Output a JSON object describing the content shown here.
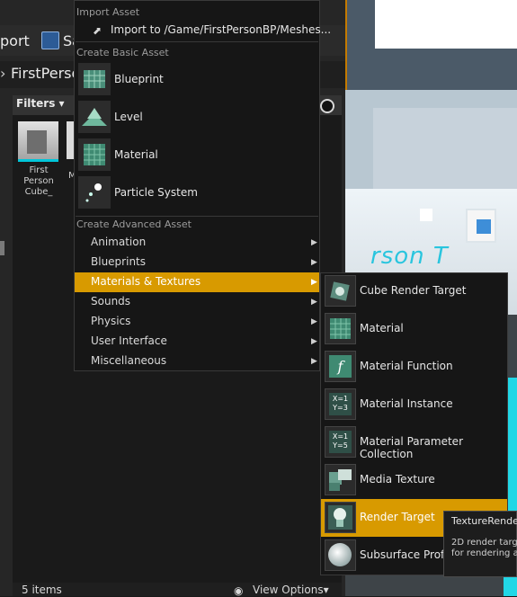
{
  "toolbar": {
    "import_label": "port",
    "save_label": "Sa"
  },
  "path_bar": {
    "folder": "FirstPerso"
  },
  "content_browser": {
    "filters_label": "Filters",
    "asset_label": "First\nPerson\nCube_",
    "asset2_label": "M",
    "status_text": "5 items",
    "view_options_label": "View Options"
  },
  "viewport": {
    "overlay_text": "rson T"
  },
  "menu": {
    "import_header": "Import Asset",
    "import_item": "Import to /Game/FirstPersonBP/Meshes...",
    "basic_header": "Create Basic Asset",
    "basic_items": [
      "Blueprint",
      "Level",
      "Material",
      "Particle System"
    ],
    "advanced_header": "Create Advanced Asset",
    "advanced_items": [
      "Animation",
      "Blueprints",
      "Materials & Textures",
      "Sounds",
      "Physics",
      "User Interface",
      "Miscellaneous"
    ],
    "highlighted_item": "Materials & Textures"
  },
  "submenu": {
    "items": [
      "Cube Render Target",
      "Material",
      "Material Function",
      "Material Instance",
      "Material Parameter Collection",
      "Media Texture",
      "Render Target",
      "Subsurface Profile"
    ],
    "highlighted_item": "Render Target",
    "icon_glyphs": {
      "instance": "X=1\nY=3",
      "param": "X=1\nY=5",
      "function": "f"
    }
  },
  "tooltip": {
    "title": "TextureRender",
    "description": "2D render targ\nfor rendering a"
  },
  "colors": {
    "highlight": "#d89a00",
    "cyan": "#00c6d9"
  }
}
